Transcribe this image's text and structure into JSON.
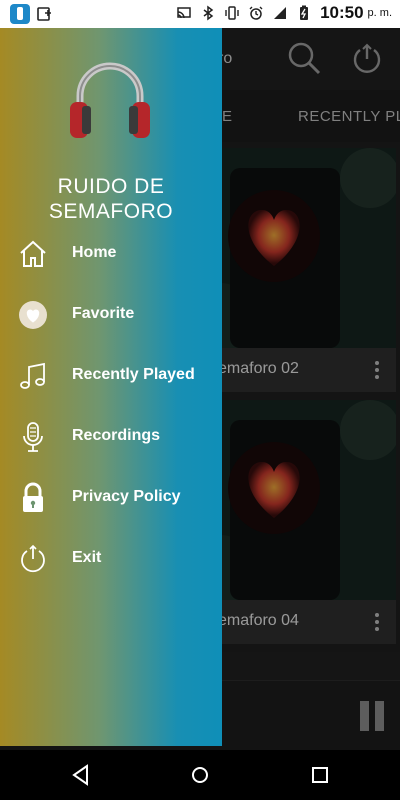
{
  "status_bar": {
    "time": "10:50",
    "ampm": "p. m.",
    "icons": [
      "traffic-light-app-icon",
      "screen-share-icon",
      "cast-icon",
      "bluetooth-icon",
      "vibrate-icon",
      "alarm-icon",
      "signal-icon",
      "battery-charging-icon"
    ]
  },
  "background_app": {
    "toolbar_title": "ro",
    "tabs": [
      {
        "label": "E"
      },
      {
        "label": "RECENTLY PL"
      }
    ],
    "cards": [
      {
        "title": "emaforo 02"
      },
      {
        "title": "emaforo 04"
      }
    ]
  },
  "drawer": {
    "app_title_line1": "RUIDO DE",
    "app_title_line2": "SEMAFORO",
    "menu": [
      {
        "label": "Home",
        "icon": "home-icon"
      },
      {
        "label": "Favorite",
        "icon": "heart-icon"
      },
      {
        "label": "Recently Played",
        "icon": "music-note-icon"
      },
      {
        "label": "Recordings",
        "icon": "microphone-icon"
      },
      {
        "label": "Privacy Policy",
        "icon": "lock-icon"
      },
      {
        "label": "Exit",
        "icon": "power-icon"
      }
    ]
  },
  "navigation": {
    "buttons": [
      "back-icon",
      "home-circle-icon",
      "recents-square-icon"
    ]
  },
  "colors": {
    "drawer_gradient_start": "#a58a24",
    "drawer_gradient_end": "#0f8fb8",
    "headphone_red": "#b5262a"
  }
}
